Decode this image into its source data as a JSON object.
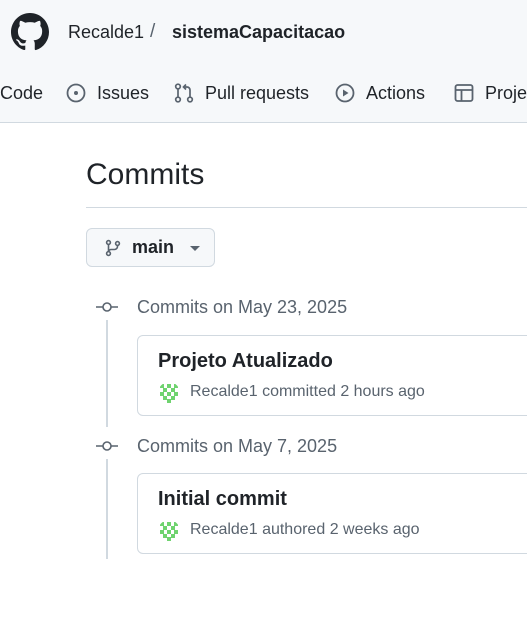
{
  "header": {
    "owner": "Recalde1",
    "separator": "/",
    "repo": "sistemaCapacitacao",
    "tabs": [
      {
        "label": "Code",
        "icon": "code-icon"
      },
      {
        "label": "Issues",
        "icon": "issue-circle-icon"
      },
      {
        "label": "Pull requests",
        "icon": "pull-request-icon"
      },
      {
        "label": "Actions",
        "icon": "play-circle-icon"
      },
      {
        "label": "Projects",
        "icon": "table-icon"
      }
    ]
  },
  "page": {
    "title": "Commits",
    "branch": "main"
  },
  "groups": [
    {
      "heading": "Commits on May 23, 2025",
      "commits": [
        {
          "title": "Projeto Atualizado",
          "author": "Recalde1",
          "action": "committed",
          "time": "2 hours ago"
        }
      ]
    },
    {
      "heading": "Commits on May 7, 2025",
      "commits": [
        {
          "title": "Initial commit",
          "author": "Recalde1",
          "action": "authored",
          "time": "2 weeks ago"
        }
      ]
    }
  ],
  "colors": {
    "header_bg": "#f6f8fa",
    "border": "#d1d9e0",
    "muted_text": "#59636e",
    "avatar_green": "#6fd36f"
  }
}
